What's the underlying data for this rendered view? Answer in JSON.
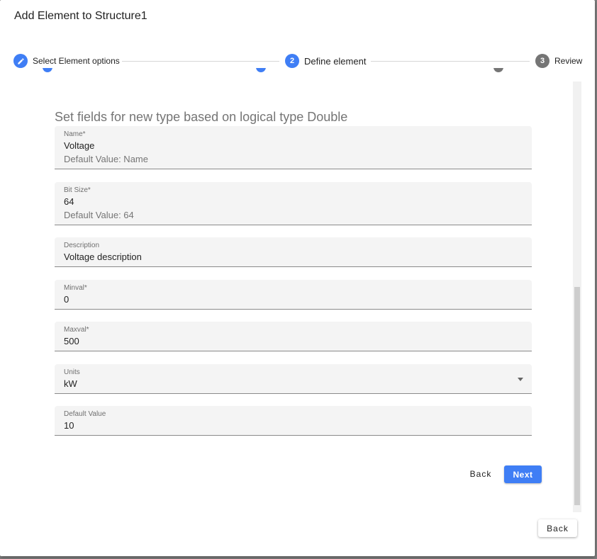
{
  "dialog": {
    "title": "Add Element to Structure1",
    "back_label": "Back"
  },
  "stepper": {
    "steps": [
      {
        "number": "",
        "label": "Select Element options",
        "icon": "pencil-icon",
        "state": "completed"
      },
      {
        "number": "2",
        "label": "Define element",
        "state": "active"
      },
      {
        "number": "3",
        "label": "Review",
        "state": "inactive"
      }
    ]
  },
  "form": {
    "heading": "Set fields for new type based on logical type Double",
    "fields": [
      {
        "label": "Name*",
        "value": "Voltage",
        "hint": "Default Value: Name"
      },
      {
        "label": "Bit Size*",
        "value": "64",
        "hint": "Default Value: 64"
      },
      {
        "label": "Description",
        "value": "Voltage description"
      },
      {
        "label": "Minval*",
        "value": "0"
      },
      {
        "label": "Maxval*",
        "value": "500"
      },
      {
        "label": "Units",
        "value": "kW",
        "type": "select"
      },
      {
        "label": "Default Value",
        "value": "10"
      }
    ],
    "back_label": "Back",
    "next_label": "Next"
  },
  "colors": {
    "accent": "#3f7ef5",
    "inactive_step": "#757575",
    "field_bg": "#f4f4f4",
    "overlay": "#7f7f7f"
  }
}
